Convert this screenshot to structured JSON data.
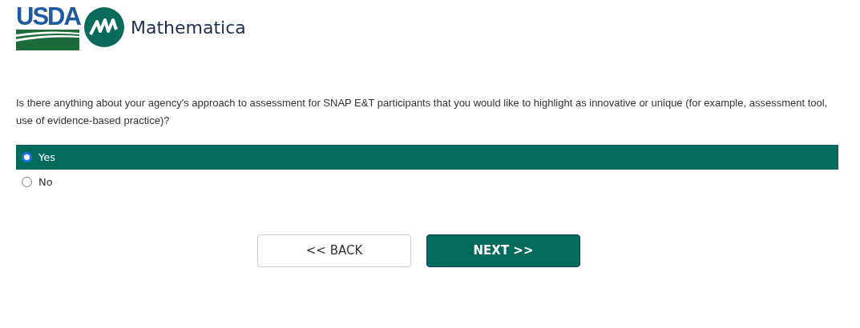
{
  "header": {
    "usda_logo": "USDA",
    "brand": "Mathematica"
  },
  "question": "Is there anything about your agency's approach to assessment for SNAP E&T participants that you would like to highlight as innovative or unique (for example, assessment tool, use of evidence-based practice)?",
  "options": [
    {
      "label": "Yes",
      "selected": true
    },
    {
      "label": "No",
      "selected": false
    }
  ],
  "buttons": [
    {
      "label": "<< BACK",
      "kind": "secondary"
    },
    {
      "label": "NEXT >>",
      "kind": "primary"
    }
  ]
}
